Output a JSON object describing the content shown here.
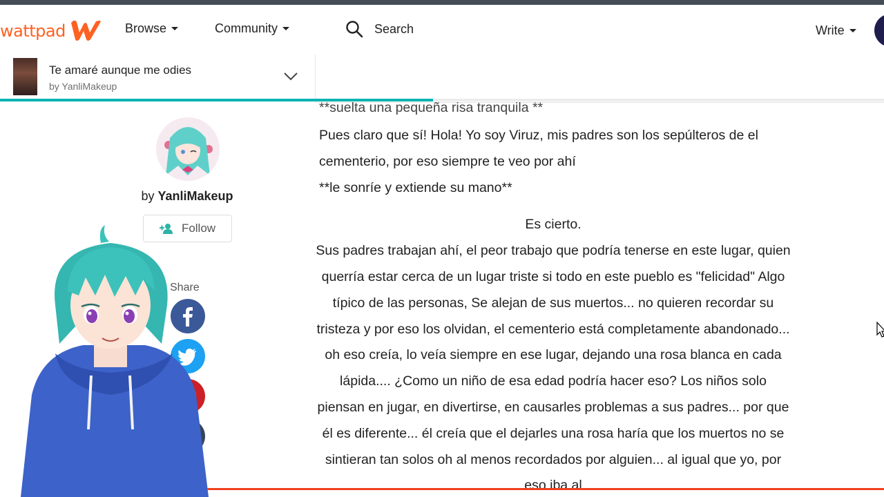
{
  "brand": {
    "name": "wattpad",
    "color": "#ff6122"
  },
  "nav": {
    "browse_label": "Browse",
    "community_label": "Community",
    "search_label": "Search",
    "write_label": "Write"
  },
  "story": {
    "title": "Te amaré aunque me odies",
    "author_byline": "by YanliMakeup",
    "reading_progress": 0.49
  },
  "author": {
    "by": "by",
    "name": "YanliMakeup",
    "follow_label": "Follow"
  },
  "share": {
    "label": "Share",
    "buttons": [
      {
        "network": "facebook",
        "icon": "facebook-icon",
        "color": "#3b5998"
      },
      {
        "network": "twitter",
        "icon": "twitter-icon",
        "color": "#1da1f2"
      },
      {
        "network": "pinterest",
        "icon": "pinterest-icon",
        "color": "#cb2027"
      },
      {
        "network": "tumblr",
        "icon": "tumblr-icon",
        "color": "#35465c"
      }
    ]
  },
  "content": {
    "partial_top_line": "**suelta una pequeña risa tranquila **",
    "para1": "Pues claro que sí! Hola! Yo soy Viruz, mis padres son los sepúlteros de el cementerio, por eso siempre te veo por ahí",
    "para2": "**le sonríe y extiende su mano**",
    "para3": "Es cierto.",
    "para4": "Sus padres trabajan ahí, el peor trabajo que podría tenerse en este lugar, quien querría estar cerca de un lugar triste si todo en este pueblo es \"felicidad\" Algo típico de las personas, Se alejan de sus muertos... no quieren recordar su tristeza y por eso los olvidan, el cementerio está completamente abandonado... oh eso creía, lo veía siempre en ese lugar, dejando una rosa blanca en cada lápida.... ¿Como un niño de esa edad podría hacer eso? Los niños solo piensan en jugar, en divertirse, en causarles problemas a sus padres... por que él es diferente... él creía que el dejarles una rosa haría que los muertos no se sintieran tan solos oh al menos recordados por alguien... al igual que yo, por eso iba al"
  }
}
